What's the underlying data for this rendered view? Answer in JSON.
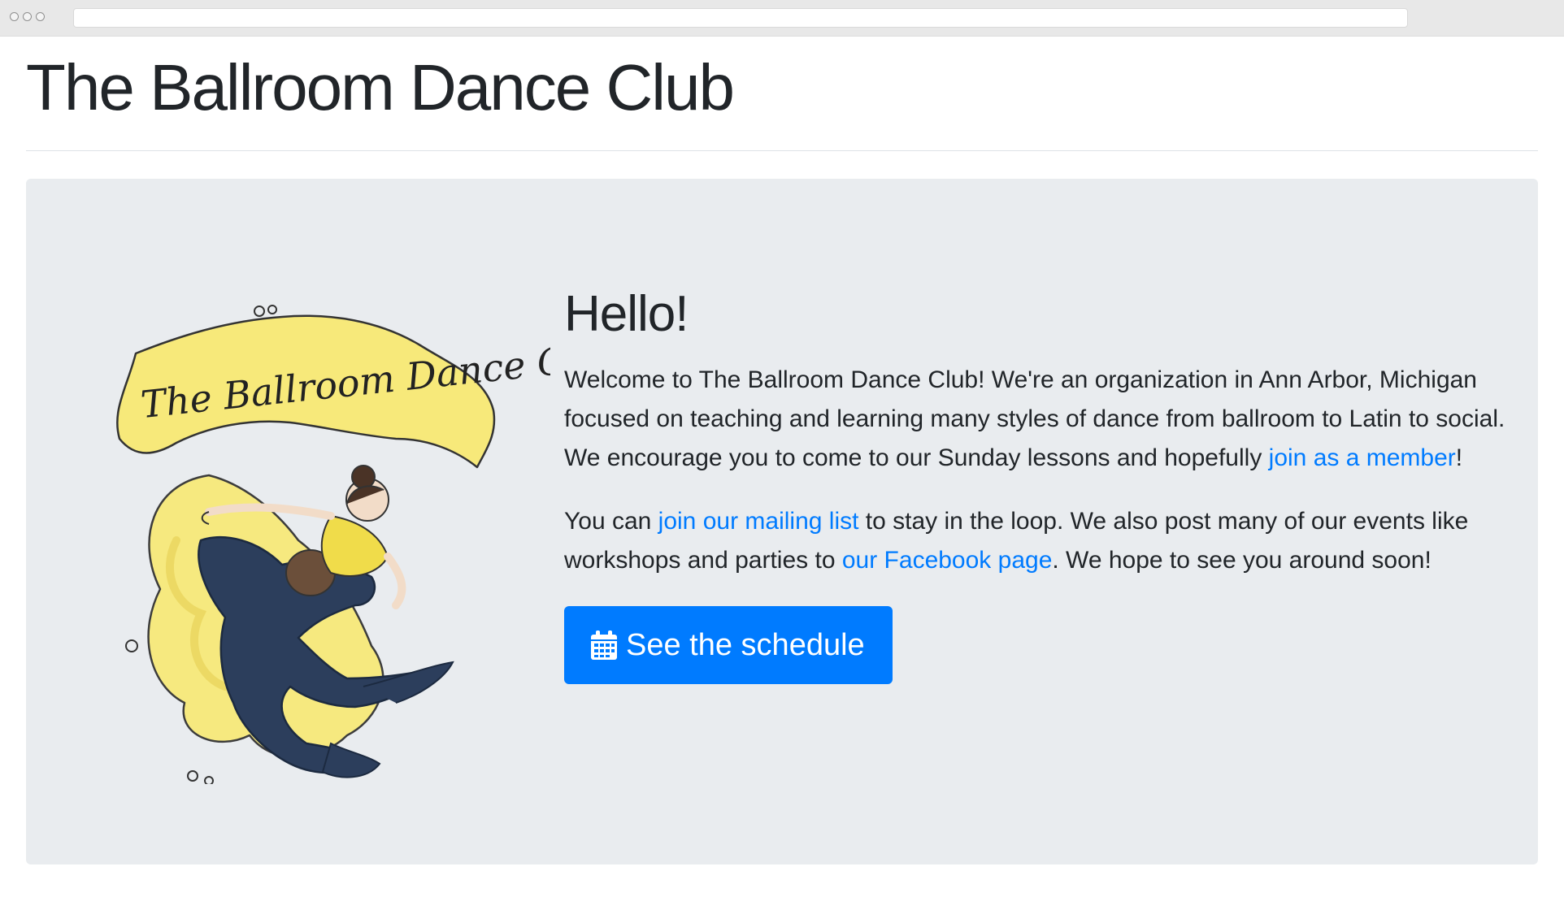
{
  "header": {
    "title": "The Ballroom Dance Club"
  },
  "hero": {
    "logo": {
      "icon": "dance-club-logo-icon",
      "banner_text": "The Ballroom Dance Club"
    },
    "heading": "Hello!",
    "paragraph1": {
      "text_before": "Welcome to The Ballroom Dance Club! We're an organization in Ann Arbor, Michigan focused on teaching and learning many styles of dance from ballroom to Latin to social. We encourage you to come to our Sunday lessons and hopefully ",
      "link_member": "join as a member",
      "text_after": "!"
    },
    "paragraph2": {
      "text_1": "You can ",
      "link_mailing": "join our mailing list",
      "text_2": " to stay in the loop. We also post many of our events like workshops and parties to ",
      "link_facebook": "our Facebook page",
      "text_3": ". We hope to see you around soon!"
    },
    "button": {
      "icon": "calendar-icon",
      "label": "See the schedule"
    }
  },
  "colors": {
    "primary": "#007bff",
    "jumbotron_bg": "#e9ecef",
    "text": "#212529",
    "logo_yellow": "#f7e97a",
    "logo_navy": "#2c3e5c"
  }
}
